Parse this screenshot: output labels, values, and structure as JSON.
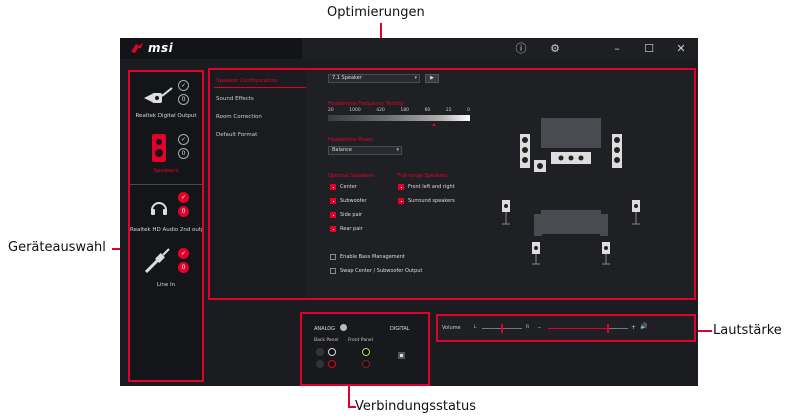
{
  "callouts": {
    "optimierungen": "Optimierungen",
    "geraeteauswahl": "Geräteauswahl",
    "lautstaerke": "Lautstärke",
    "verbindungsstatus": "Verbindungsstatus"
  },
  "app": {
    "logo_text": "msi",
    "title_icons": [
      "info-icon",
      "gear-icon",
      "minimize-icon",
      "maximize-icon",
      "close-icon"
    ],
    "title_glyphs": {
      "info": "ⓘ",
      "settings": "⚙",
      "minimize": "–",
      "maximize": "☐",
      "close": "✕"
    }
  },
  "devices": [
    {
      "label": "Realtek Digital Output",
      "icon": "digital-output-icon",
      "badge_check": "✓",
      "badge_info": "0",
      "active": false
    },
    {
      "label": "Speakers",
      "icon": "speakers-icon",
      "badge_check": "✓",
      "badge_info": "0",
      "active": true
    },
    {
      "label": "Realtek HD Audio 2nd outpu",
      "icon": "headphones-icon",
      "badge_check": "✓",
      "badge_info": "0",
      "active": false
    },
    {
      "label": "Line In",
      "icon": "line-in-icon",
      "badge_check": "✓",
      "badge_info": "0",
      "active": false
    }
  ],
  "nav": [
    {
      "label": "Speaker Configuration",
      "active": true
    },
    {
      "label": "Sound Effects",
      "active": false
    },
    {
      "label": "Room Correction",
      "active": false
    },
    {
      "label": "Default Format",
      "active": false
    }
  ],
  "speaker_config": {
    "speaker_select": "7.1 Speaker",
    "play_glyph": "▶",
    "fullrange_title": "Headphone Frequency Testing",
    "freq_labels": [
      "20",
      "1000",
      "420",
      "180",
      "60",
      "22",
      "0"
    ],
    "bass_title": "Headphone Power",
    "bass_select": "Balance",
    "optional_title": "Optional Speakers",
    "optional": [
      {
        "label": "Center",
        "checked": true
      },
      {
        "label": "Subwoofer",
        "checked": true
      },
      {
        "label": "Side pair",
        "checked": true
      },
      {
        "label": "Rear pair",
        "checked": true
      }
    ],
    "fullrange_speakers_title": "Full-range Speakers",
    "fullrange": [
      {
        "label": "Front left and right",
        "checked": true
      },
      {
        "label": "Surround speakers",
        "checked": true
      }
    ],
    "extra_options": [
      {
        "label": "Enable Bass Management",
        "checked": false
      },
      {
        "label": "Swap Center / Subwoofer Output",
        "checked": false
      }
    ]
  },
  "connection": {
    "analog_label": "ANALOG",
    "digital_label": "DIGITAL",
    "back_panel": "Back Panel",
    "front_panel": "Front Panel"
  },
  "volume": {
    "label": "Volume",
    "left": "L",
    "right": "R",
    "minus": "–",
    "plus": "+",
    "speaker_glyph": "🔊",
    "balance": 0.5,
    "level": 0.75
  },
  "colors": {
    "accent": "#e4002b",
    "background": "#1b1c20"
  }
}
